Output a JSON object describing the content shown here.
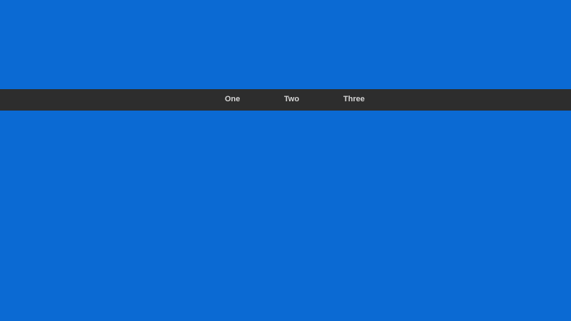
{
  "colors": {
    "background": "#0b6ad3",
    "navbar": "#2d2d2d",
    "nav_text": "#d6d6d6"
  },
  "nav": {
    "items": [
      {
        "label": "One"
      },
      {
        "label": "Two"
      },
      {
        "label": "Three"
      }
    ]
  }
}
